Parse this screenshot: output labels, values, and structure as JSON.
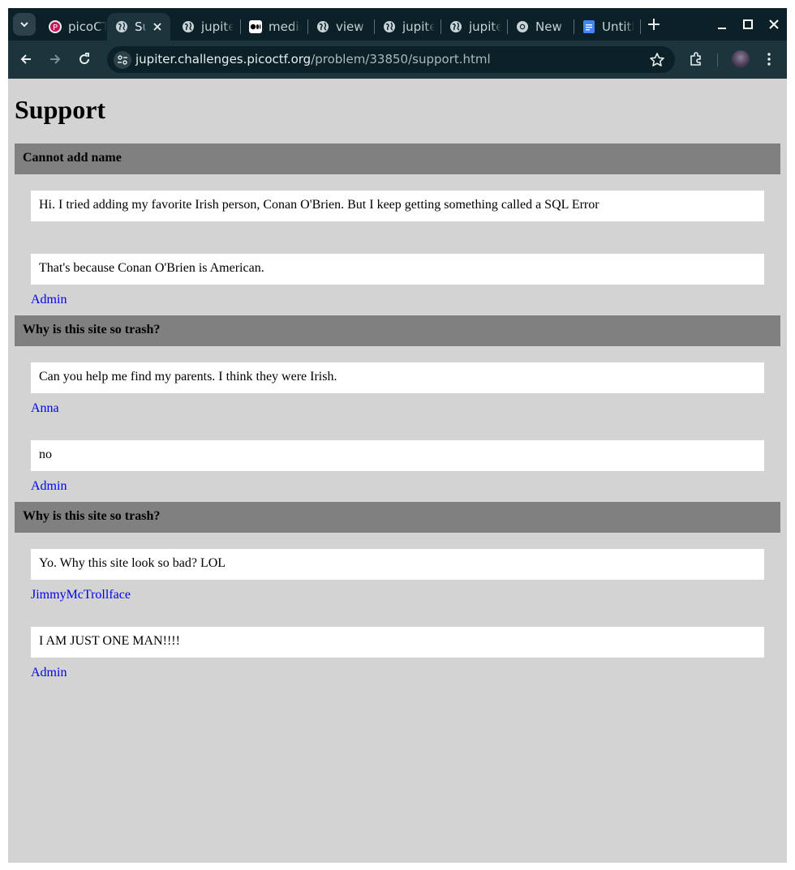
{
  "browser": {
    "tabs": [
      {
        "label": "picoCTF",
        "favicon": "picoctf-icon",
        "active": false
      },
      {
        "label": "Support",
        "favicon": "globe-icon",
        "active": true
      },
      {
        "label": "jupiter",
        "favicon": "globe-icon",
        "active": false
      },
      {
        "label": "medium",
        "favicon": "medium-icon",
        "active": false
      },
      {
        "label": "view",
        "favicon": "globe-icon",
        "active": false
      },
      {
        "label": "jupiter",
        "favicon": "globe-icon",
        "active": false
      },
      {
        "label": "jupiter",
        "favicon": "globe-icon",
        "active": false
      },
      {
        "label": "New",
        "favicon": "chrome-icon",
        "active": false
      },
      {
        "label": "Untitled",
        "favicon": "docs-icon",
        "active": false
      }
    ],
    "url": {
      "host": "jupiter.challenges.picoctf.org",
      "path": "/problem/33850/support.html"
    }
  },
  "page": {
    "title": "Support",
    "topics": [
      {
        "title": "Cannot add name",
        "posts": [
          {
            "text": "Hi. I tried adding my favorite Irish person, Conan O'Brien. But I keep getting something called a SQL Error",
            "author": ""
          },
          {
            "text": "That's because Conan O'Brien is American.",
            "author": "Admin"
          }
        ]
      },
      {
        "title": "Why is this site so trash?",
        "posts": [
          {
            "text": "Can you help me find my parents. I think they were Irish.",
            "author": "Anna"
          },
          {
            "text": "no",
            "author": "Admin"
          }
        ]
      },
      {
        "title": "Why is this site so trash?",
        "posts": [
          {
            "text": "Yo. Why this site look so bad? LOL",
            "author": "JimmyMcTrollface"
          },
          {
            "text": "I AM JUST ONE MAN!!!!",
            "author": "Admin"
          }
        ]
      }
    ]
  },
  "colors": {
    "page_background": "#d3d3d3",
    "topic_header": "#808080",
    "post_background": "#ffffff",
    "link": "#0000ee"
  }
}
